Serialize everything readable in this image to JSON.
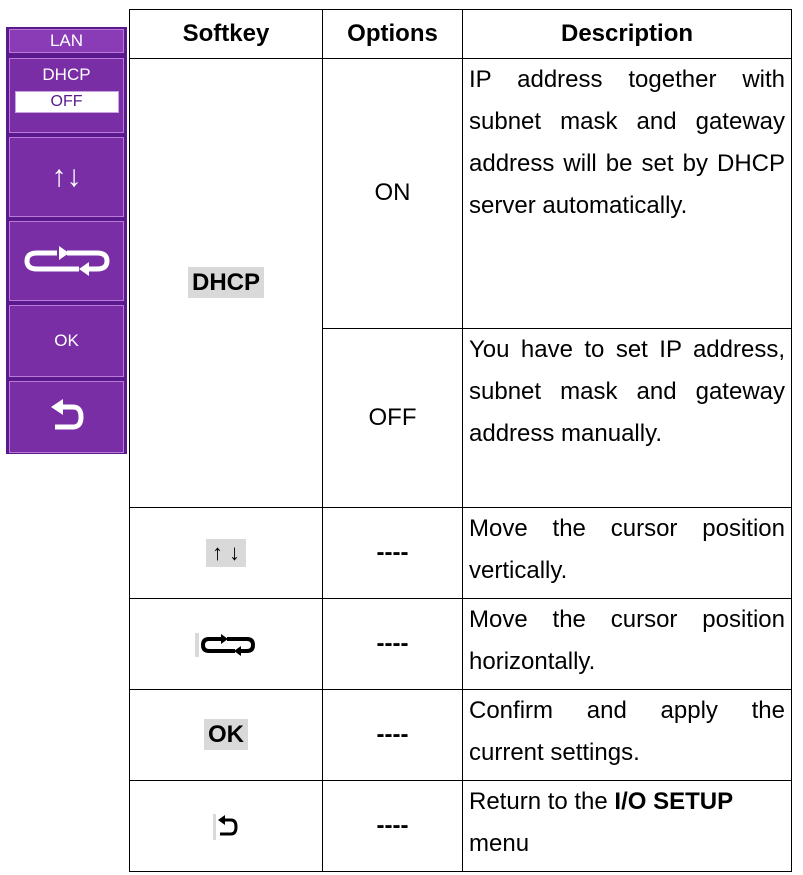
{
  "softkey_panel": {
    "title": "LAN",
    "dhcp_label": "DHCP",
    "dhcp_value": "OFF",
    "ok_label": "OK",
    "colors": {
      "panel": "#5a1a8e",
      "key": "#7a2ea6",
      "text": "#ffffff"
    }
  },
  "table": {
    "headers": [
      "Softkey",
      "Options",
      "Description"
    ],
    "rows": {
      "dhcp": {
        "softkey": "DHCP",
        "options": [
          {
            "option": "ON",
            "description": "IP address together with subnet mask and gateway address will be set by DHCP server automatically."
          },
          {
            "option": "OFF",
            "description": "You have to set IP address, subnet mask and gateway address manually."
          }
        ]
      },
      "updown": {
        "icon": "up-down-arrows-icon",
        "option": "----",
        "description": "Move the cursor position vertically."
      },
      "leftright": {
        "icon": "cycle-arrows-icon",
        "option": "----",
        "description": "Move the cursor position horizontally."
      },
      "ok": {
        "softkey": "OK",
        "option": "----",
        "description": "Confirm and apply the current settings."
      },
      "back": {
        "icon": "return-arrow-icon",
        "option": "----",
        "description_before": "Return to the ",
        "description_bold": "I/O SETUP",
        "description_after": " menu"
      }
    }
  }
}
